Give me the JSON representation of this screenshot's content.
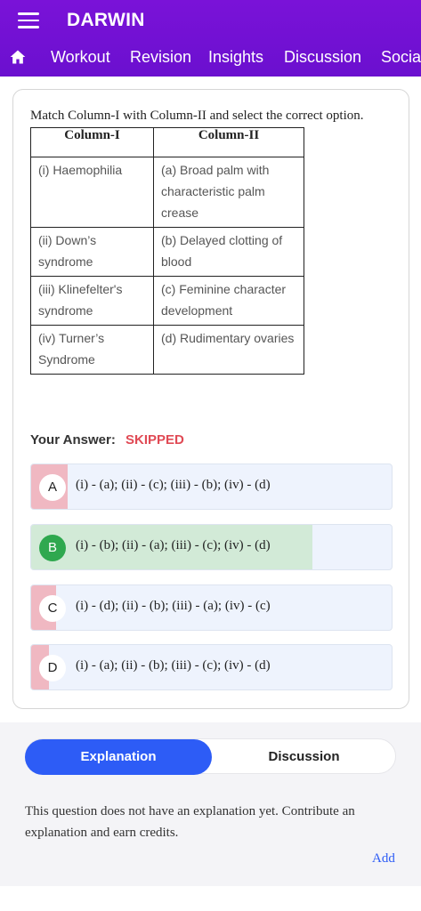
{
  "header": {
    "app_title": "DARWIN",
    "nav": [
      "Workout",
      "Revision",
      "Insights",
      "Discussion",
      "Social"
    ]
  },
  "question": {
    "text": "Match Column-I with Column-II and select the correct option.",
    "table": {
      "headers": [
        "Column-I",
        "Column-II"
      ],
      "rows": [
        [
          "(i) Haemophilia",
          "(a) Broad palm with characteristic palm crease"
        ],
        [
          "(ii) Down’s syndrome",
          "(b) Delayed clotting of blood"
        ],
        [
          "(iii) Klinefelter's syndrome",
          "(c) Feminine character development"
        ],
        [
          "(iv) Turner’s Syndrome",
          "(d) Rudimentary ovaries"
        ]
      ]
    }
  },
  "answer": {
    "label": "Your Answer:",
    "status": "SKIPPED"
  },
  "options": [
    {
      "letter": "A",
      "text": "(i) - (a); (ii) - (c); (iii) - (b); (iv) - (d)",
      "share": 0.1,
      "color": "#f0b8c2"
    },
    {
      "letter": "B",
      "text": "(i) - (b); (ii) - (a); (iii) - (c); (iv) - (d)",
      "share": 0.78,
      "color": "#d2ead7",
      "correct": true
    },
    {
      "letter": "C",
      "text": "(i) - (d); (ii) - (b); (iii) - (a); (iv) - (c)",
      "share": 0.07,
      "color": "#f0b8c2"
    },
    {
      "letter": "D",
      "text": "(i) - (a); (ii) - (b); (iii) - (c); (iv) - (d)",
      "share": 0.05,
      "color": "#f0b8c2"
    }
  ],
  "explanation": {
    "tabs": [
      "Explanation",
      "Discussion"
    ],
    "text": "This question does not have an explanation yet. Contribute an explanation and earn credits.",
    "add_label": "Add"
  },
  "colors": {
    "header": "#7a12d8",
    "accent": "#2d5cf6",
    "correct": "#2fa84f",
    "skipped": "#e04a55"
  }
}
